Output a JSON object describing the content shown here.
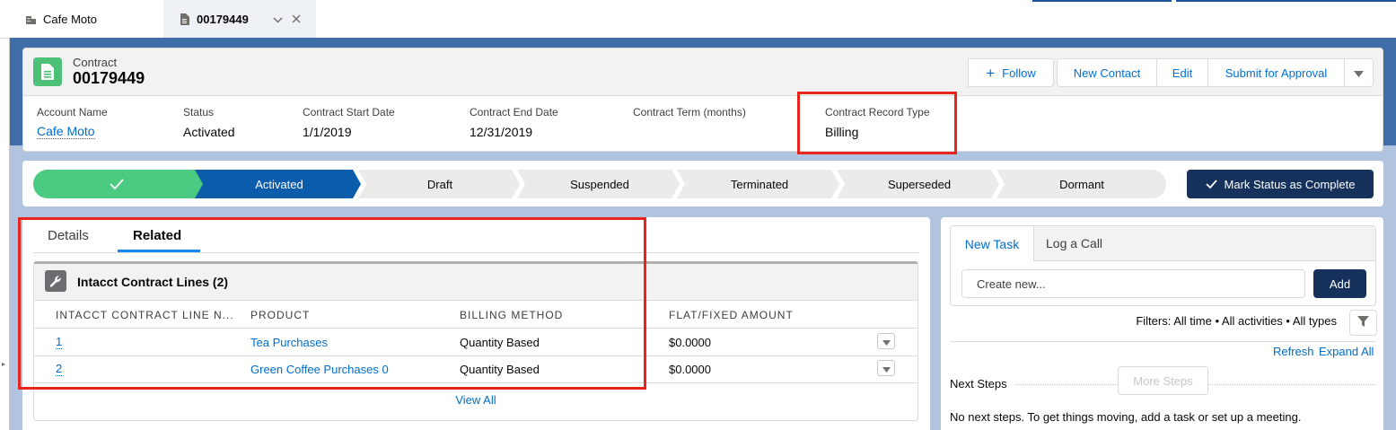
{
  "tabs": [
    {
      "label": "Cafe Moto",
      "icon": "account-icon"
    },
    {
      "label": "00179449",
      "icon": "contract-icon"
    }
  ],
  "record": {
    "object_type": "Contract",
    "title": "00179449",
    "icon": "contract-icon",
    "icon_color": "#4bc076",
    "actions": {
      "follow": "Follow",
      "new_contact": "New Contact",
      "edit": "Edit",
      "submit": "Submit for Approval"
    },
    "fields": [
      {
        "label": "Account Name",
        "value": "Cafe Moto",
        "link": true
      },
      {
        "label": "Status",
        "value": "Activated"
      },
      {
        "label": "Contract Start Date",
        "value": "1/1/2019"
      },
      {
        "label": "Contract End Date",
        "value": "12/31/2019"
      },
      {
        "label": "Contract Term (months)",
        "value": ""
      },
      {
        "label": "Contract Record Type",
        "value": "Billing"
      }
    ]
  },
  "path": {
    "stages": [
      "Activated",
      "Draft",
      "Suspended",
      "Terminated",
      "Superseded",
      "Dormant"
    ],
    "current": "Activated",
    "complete_color": "#4bca81",
    "current_color": "#0b5cab",
    "mark_button": "Mark Status as Complete"
  },
  "main_tabs": {
    "details": "Details",
    "related": "Related",
    "active": "Related"
  },
  "related_list": {
    "title": "Intacct Contract Lines (2)",
    "columns": [
      "INTACCT CONTRACT LINE N...",
      "PRODUCT",
      "BILLING METHOD",
      "FLAT/FIXED AMOUNT"
    ],
    "rows": [
      {
        "line": "1",
        "product": "Tea Purchases",
        "billing": "Quantity Based",
        "amount": "$0.0000"
      },
      {
        "line": "2",
        "product": "Green Coffee Purchases 0",
        "billing": "Quantity Based",
        "amount": "$0.0000"
      }
    ],
    "view_all": "View All"
  },
  "activity": {
    "tabs": [
      "New Task",
      "Log a Call"
    ],
    "active_tab": "New Task",
    "input_placeholder": "Create new...",
    "add_button": "Add",
    "filters": "Filters: All time • All activities • All types",
    "refresh": "Refresh",
    "expand_all": "Expand All",
    "next_steps": "Next Steps",
    "more_steps": "More Steps",
    "empty_message": "No next steps. To get things moving, add a task or set up a meeting."
  },
  "colors": {
    "brand_blue": "#0070d2",
    "dark_button": "#16325c",
    "annotation_red": "#e8241c"
  }
}
